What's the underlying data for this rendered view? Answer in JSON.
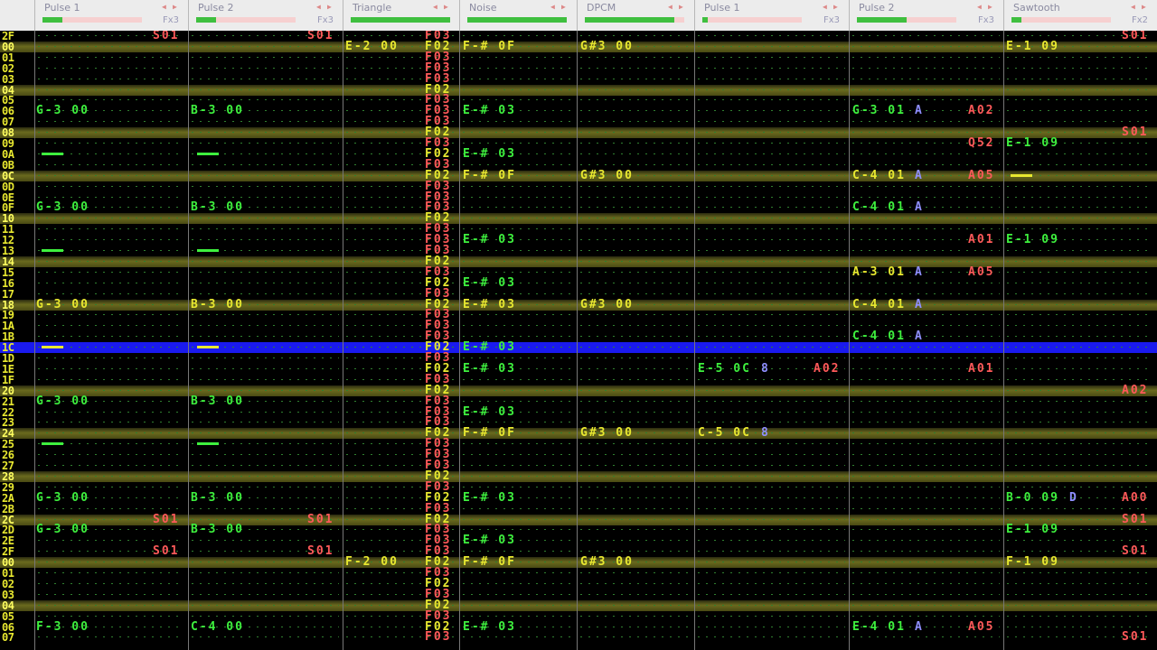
{
  "channels": [
    {
      "name": "Pulse 1",
      "fx": "Fx3",
      "vol": 0.2
    },
    {
      "name": "Pulse 2",
      "fx": "Fx3",
      "vol": 0.2
    },
    {
      "name": "Triangle",
      "fx": "",
      "vol": 1.0
    },
    {
      "name": "Noise",
      "fx": "",
      "vol": 1.0
    },
    {
      "name": "DPCM",
      "fx": "",
      "vol": 0.9
    },
    {
      "name": "Pulse 1",
      "fx": "Fx3",
      "vol": 0.05
    },
    {
      "name": "Pulse 2",
      "fx": "Fx3",
      "vol": 0.5
    },
    {
      "name": "Sawtooth",
      "fx": "Fx2",
      "vol": 0.1
    }
  ],
  "colors": {
    "note": "#3ef03e",
    "highlight_note": "#e8e830",
    "effect": "#ff5a5a",
    "instrument_letter": "#8f8fff",
    "cursor_row": "#1a1aee"
  },
  "rows": [
    {
      "n": "2F",
      "cells": {
        "pulse1_fx": "S01",
        "pulse2_fx": "S01",
        "noise_fx": "F03",
        "saw_fx": "S01"
      }
    },
    {
      "n": "00",
      "hl": true,
      "cells": {
        "tri": "E-2 00",
        "noise_fx": "F02",
        "noise": "F-# 0F",
        "dpcm": "G#3 00",
        "saw": "E-1 09"
      }
    },
    {
      "n": "01",
      "cells": {
        "noise_fx": "F03"
      }
    },
    {
      "n": "02",
      "cells": {
        "noise_fx": "F03"
      }
    },
    {
      "n": "03",
      "cells": {
        "noise_fx": "F03"
      }
    },
    {
      "n": "04",
      "hl": true,
      "cells": {
        "noise_fx": "F02"
      }
    },
    {
      "n": "05",
      "cells": {
        "noise_fx": "F03"
      }
    },
    {
      "n": "06",
      "cells": {
        "pulse1": "G-3 00",
        "pulse2": "B-3 00",
        "noise_fx": "F03",
        "noise": "E-# 03",
        "p2b": "G-3 01",
        "p2b_i": "A",
        "p2b_fx": "A02"
      }
    },
    {
      "n": "07",
      "cells": {
        "noise_fx": "F03"
      }
    },
    {
      "n": "08",
      "hl": true,
      "cells": {
        "noise_fx": "F02",
        "saw_fx": "S01"
      }
    },
    {
      "n": "09",
      "cells": {
        "noise_fx": "F03",
        "p2b_fx": "Q52",
        "saw": "E-1 09"
      }
    },
    {
      "n": "0A",
      "cells": {
        "pulse1_rel": true,
        "pulse2_rel": true,
        "noise_fx": "F02",
        "noise": "E-# 03"
      }
    },
    {
      "n": "0B",
      "cells": {
        "noise_fx": "F03"
      }
    },
    {
      "n": "0C",
      "hl": true,
      "cells": {
        "noise_fx": "F02",
        "noise": "F-# 0F",
        "dpcm": "G#3 00",
        "p2b": "C-4 01",
        "p2b_i": "A",
        "p2b_fx": "A05",
        "saw_rel": true
      }
    },
    {
      "n": "0D",
      "cells": {
        "noise_fx": "F03"
      }
    },
    {
      "n": "0E",
      "cells": {
        "noise_fx": "F03"
      }
    },
    {
      "n": "0F",
      "cells": {
        "pulse1": "G-3 00",
        "pulse2": "B-3 00",
        "noise_fx": "F03",
        "p2b": "C-4 01",
        "p2b_i": "A"
      }
    },
    {
      "n": "10",
      "hl": true,
      "cells": {
        "noise_fx": "F02"
      }
    },
    {
      "n": "11",
      "cells": {
        "noise_fx": "F03"
      }
    },
    {
      "n": "12",
      "cells": {
        "noise_fx": "F03",
        "noise": "E-# 03",
        "p2b_fx": "A01",
        "saw": "E-1 09"
      }
    },
    {
      "n": "13",
      "cells": {
        "pulse1_rel": true,
        "pulse2_rel": true,
        "noise_fx": "F03"
      }
    },
    {
      "n": "14",
      "hl": true,
      "cells": {
        "noise_fx": "F02"
      }
    },
    {
      "n": "15",
      "cells": {
        "noise_fx": "F03",
        "p2b": "A-3 01",
        "p2b_i": "A",
        "p2b_fx": "A05"
      }
    },
    {
      "n": "16",
      "cells": {
        "noise_fx": "F02",
        "noise": "E-# 03"
      }
    },
    {
      "n": "17",
      "cells": {
        "noise_fx": "F03"
      }
    },
    {
      "n": "18",
      "hl": true,
      "cells": {
        "pulse1": "G-3 00",
        "pulse2": "B-3 00",
        "noise_fx": "F02",
        "noise": "E-# 03",
        "dpcm": "G#3 00",
        "p2b": "C-4 01",
        "p2b_i": "A"
      }
    },
    {
      "n": "19",
      "cells": {
        "noise_fx": "F03"
      }
    },
    {
      "n": "1A",
      "cells": {
        "noise_fx": "F03"
      }
    },
    {
      "n": "1B",
      "cells": {
        "noise_fx": "F03",
        "p2b": "C-4 01",
        "p2b_i": "A"
      }
    },
    {
      "n": "1C",
      "cur": true,
      "cells": {
        "pulse1_rel": true,
        "pulse2_rel": true,
        "noise_fx": "F02",
        "noise": "E-# 03"
      }
    },
    {
      "n": "1D",
      "cells": {
        "noise_fx": "F03"
      }
    },
    {
      "n": "1E",
      "cells": {
        "noise_fx": "F02",
        "noise": "E-# 03",
        "p1b": "E-5 0C",
        "p1b_i": "8",
        "p1b_fx": "A02",
        "p2b_fx": "A01"
      }
    },
    {
      "n": "1F",
      "cells": {
        "noise_fx": "F03"
      }
    },
    {
      "n": "20",
      "hl": true,
      "cells": {
        "noise_fx": "F02",
        "saw_fx": "A02"
      }
    },
    {
      "n": "21",
      "cells": {
        "pulse1": "G-3 00",
        "pulse2": "B-3 00",
        "noise_fx": "F03"
      }
    },
    {
      "n": "22",
      "cells": {
        "noise_fx": "F03",
        "noise": "E-# 03"
      }
    },
    {
      "n": "23",
      "cells": {
        "noise_fx": "F03"
      }
    },
    {
      "n": "24",
      "hl": true,
      "cells": {
        "noise_fx": "F02",
        "noise": "F-# 0F",
        "dpcm": "G#3 00",
        "p1b": "C-5 0C",
        "p1b_i": "8"
      }
    },
    {
      "n": "25",
      "cells": {
        "pulse1_rel": true,
        "pulse2_rel": true,
        "noise_fx": "F03"
      }
    },
    {
      "n": "26",
      "cells": {
        "noise_fx": "F03"
      }
    },
    {
      "n": "27",
      "cells": {
        "noise_fx": "F03"
      }
    },
    {
      "n": "28",
      "hl": true,
      "cells": {
        "noise_fx": "F02"
      }
    },
    {
      "n": "29",
      "cells": {
        "noise_fx": "F03"
      }
    },
    {
      "n": "2A",
      "cells": {
        "pulse1": "G-3 00",
        "pulse2": "B-3 00",
        "noise_fx": "F02",
        "noise": "E-# 03",
        "saw": "B-0 09",
        "saw_i": "D",
        "saw_fx": "A00"
      }
    },
    {
      "n": "2B",
      "cells": {
        "noise_fx": "F03"
      }
    },
    {
      "n": "2C",
      "hl": true,
      "cells": {
        "pulse1_fx": "S01",
        "pulse2_fx": "S01",
        "noise_fx": "F02",
        "saw_fx": "S01"
      }
    },
    {
      "n": "2D",
      "cells": {
        "pulse1": "G-3 00",
        "pulse2": "B-3 00",
        "noise_fx": "F03",
        "saw": "E-1 09"
      }
    },
    {
      "n": "2E",
      "cells": {
        "noise_fx": "F03",
        "noise": "E-# 03"
      }
    },
    {
      "n": "2F",
      "cells": {
        "pulse1_fx": "S01",
        "pulse2_fx": "S01",
        "noise_fx": "F03",
        "saw_fx": "S01"
      }
    },
    {
      "n": "00",
      "hl": true,
      "cells": {
        "tri": "F-2 00",
        "noise_fx": "F02",
        "noise": "F-# 0F",
        "dpcm": "G#3 00",
        "saw": "F-1 09"
      }
    },
    {
      "n": "01",
      "cells": {
        "noise_fx": "F03"
      }
    },
    {
      "n": "02",
      "cells": {
        "noise_fx": "F02"
      }
    },
    {
      "n": "03",
      "cells": {
        "noise_fx": "F03"
      }
    },
    {
      "n": "04",
      "hl": true,
      "cells": {
        "noise_fx": "F02"
      }
    },
    {
      "n": "05",
      "cells": {
        "noise_fx": "F03"
      }
    },
    {
      "n": "06",
      "cells": {
        "pulse1": "F-3 00",
        "pulse2": "C-4 00",
        "noise_fx": "F02",
        "noise": "E-# 03",
        "p2b": "E-4 01",
        "p2b_i": "A",
        "p2b_fx": "A05"
      }
    },
    {
      "n": "07",
      "cells": {
        "noise_fx": "F03",
        "saw_fx": "S01"
      }
    }
  ]
}
